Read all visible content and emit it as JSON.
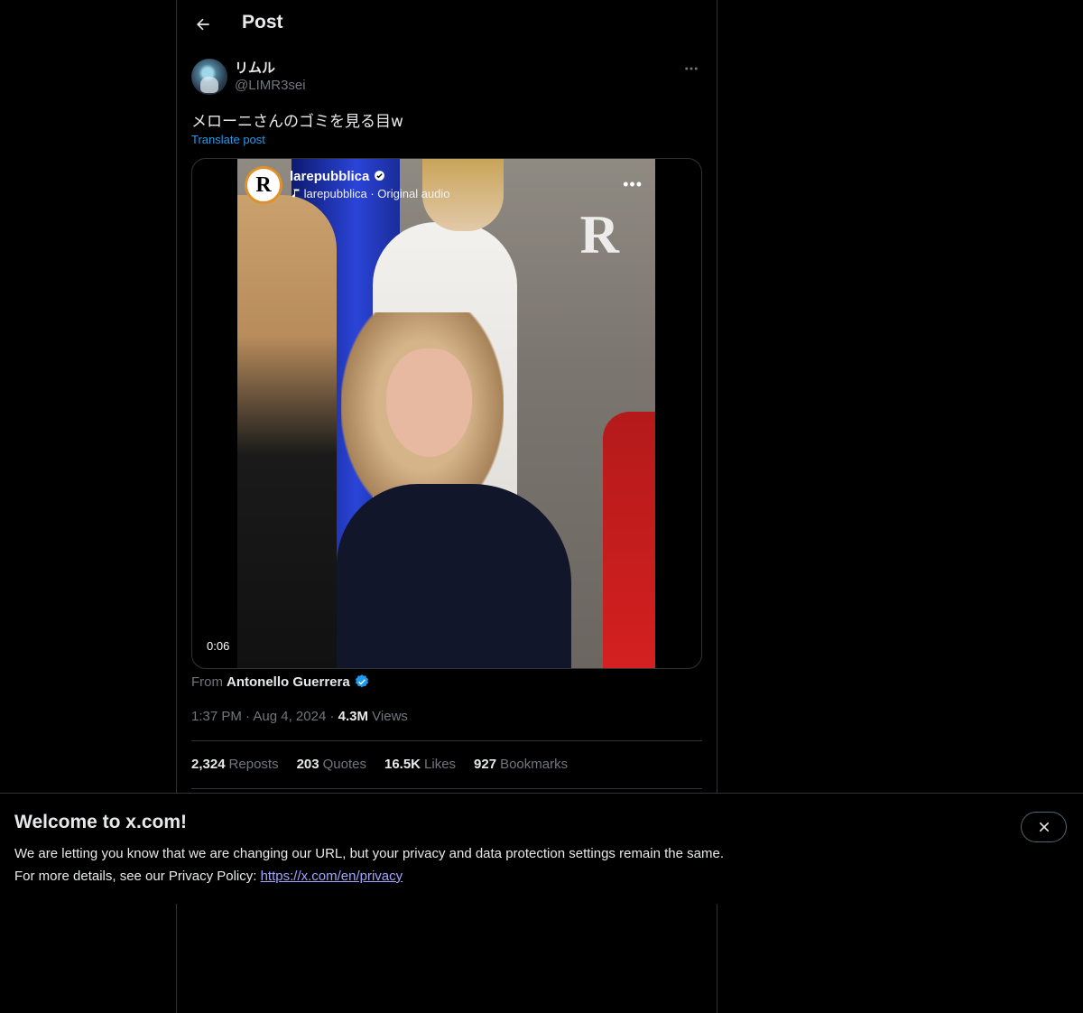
{
  "header": {
    "title": "Post"
  },
  "author": {
    "display_name": "リムル",
    "handle": "@LIMR3sei"
  },
  "post": {
    "text": "メローニさんのゴミを見る目w",
    "translate_label": "Translate post"
  },
  "media": {
    "account": "larepubblica",
    "audio": "larepubblica · Original audio",
    "watermark": "R",
    "logo_letter": "R",
    "duration": "0:06"
  },
  "attribution": {
    "prefix": "From",
    "name": "Antonello Guerrera"
  },
  "meta": {
    "time": "1:37 PM",
    "sep1": "·",
    "date": "Aug 4, 2024",
    "sep2": "·",
    "views_count": "4.3M",
    "views_label": "Views"
  },
  "stats": [
    {
      "count": "2,324",
      "label": "Reposts"
    },
    {
      "count": "203",
      "label": "Quotes"
    },
    {
      "count": "16.5K",
      "label": "Likes"
    },
    {
      "count": "927",
      "label": "Bookmarks"
    }
  ],
  "banner": {
    "title": "Welcome to x.com!",
    "line1": "We are letting you know that we are changing our URL, but your privacy and data protection settings remain the same.",
    "line2_prefix": "For more details, see our Privacy Policy: ",
    "link": "https://x.com/en/privacy"
  },
  "colors": {
    "accent": "#1d9bf0",
    "link": "#a1a4ff",
    "muted": "#71767b",
    "border": "#2f3336"
  },
  "icons": [
    "back-arrow-icon",
    "more-icon",
    "verified-icon",
    "music-note-icon",
    "close-icon"
  ]
}
